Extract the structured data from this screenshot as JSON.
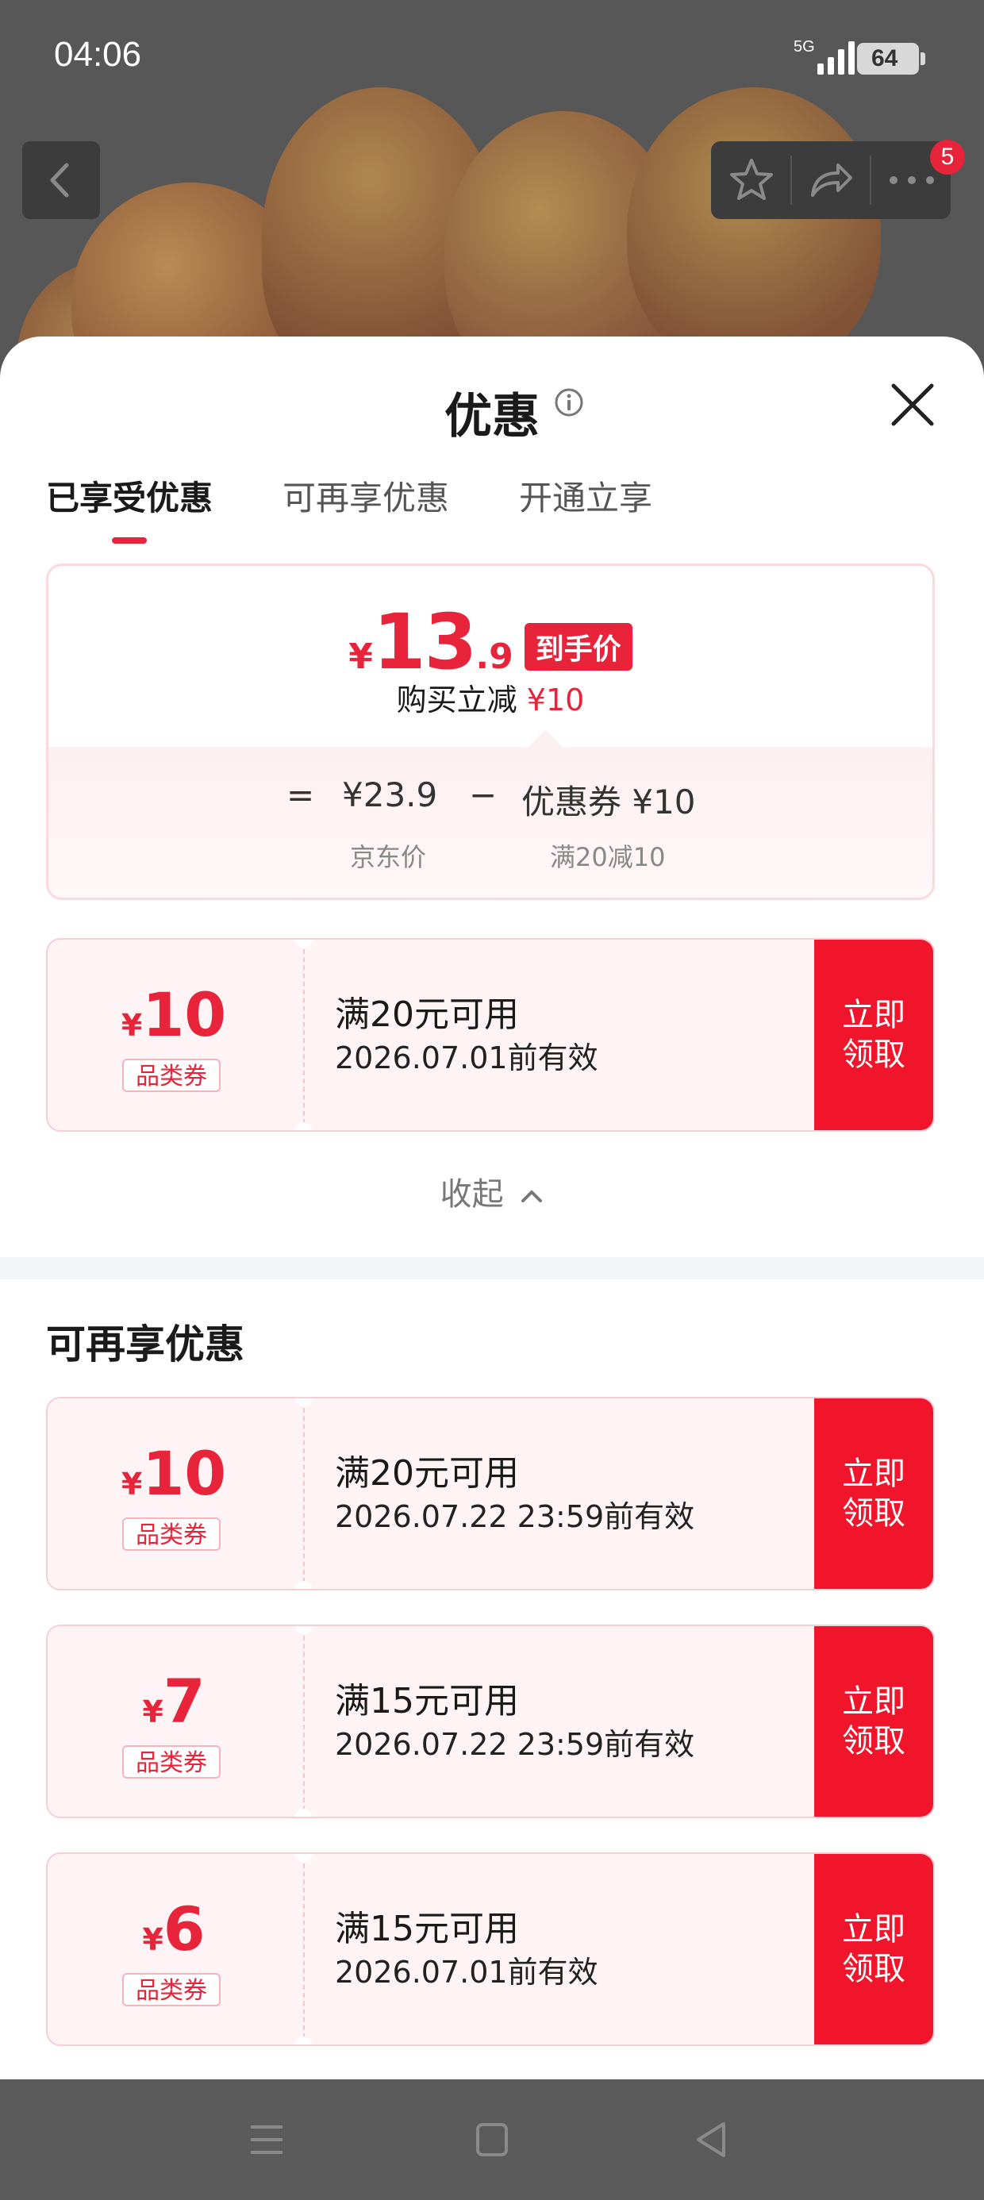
{
  "status_bar": {
    "time": "04:06",
    "network": "5G",
    "battery": "64"
  },
  "header": {
    "cart_badge": "5"
  },
  "sheet": {
    "title": "优惠",
    "tabs": [
      {
        "label": "已享受优惠",
        "active": true
      },
      {
        "label": "可再享优惠",
        "active": false
      },
      {
        "label": "开通立享",
        "active": false
      }
    ]
  },
  "price_card": {
    "currency": "¥",
    "price_int": "13",
    "price_dec": ".9",
    "price_tag": "到手价",
    "reduce_label": "购买立减",
    "reduce_amount": "¥10",
    "formula_eq": "=",
    "formula_price": "¥23.9",
    "formula_minus": "−",
    "formula_coupon": "优惠券 ¥10",
    "caption_price": "京东价",
    "caption_coupon": "满20减10"
  },
  "claimed_coupon": {
    "currency": "¥",
    "amount": "10",
    "type": "品类券",
    "condition": "满20元可用",
    "expiry": "2026.07.01前有效",
    "button": "立即领取"
  },
  "collapse_label": "收起",
  "more_section_title": "可再享优惠",
  "more_coupons": [
    {
      "currency": "¥",
      "amount": "10",
      "type": "品类券",
      "condition": "满20元可用",
      "expiry": "2026.07.22 23:59前有效",
      "button": "立即领取"
    },
    {
      "currency": "¥",
      "amount": "7",
      "type": "品类券",
      "condition": "满15元可用",
      "expiry": "2026.07.22 23:59前有效",
      "button": "立即领取"
    },
    {
      "currency": "¥",
      "amount": "6",
      "type": "品类券",
      "condition": "满15元可用",
      "expiry": "2026.07.01前有效",
      "button": "立即领取"
    }
  ],
  "icons": [
    "back-arrow-icon",
    "star-icon",
    "share-icon",
    "more-icon",
    "info-icon",
    "close-icon",
    "chevron-up-icon",
    "menu-icon",
    "home-icon",
    "back-triangle-icon"
  ],
  "colors": {
    "accent": "#e8243a",
    "button": "#f0152b",
    "coupon_bg": "#fef4f5"
  }
}
